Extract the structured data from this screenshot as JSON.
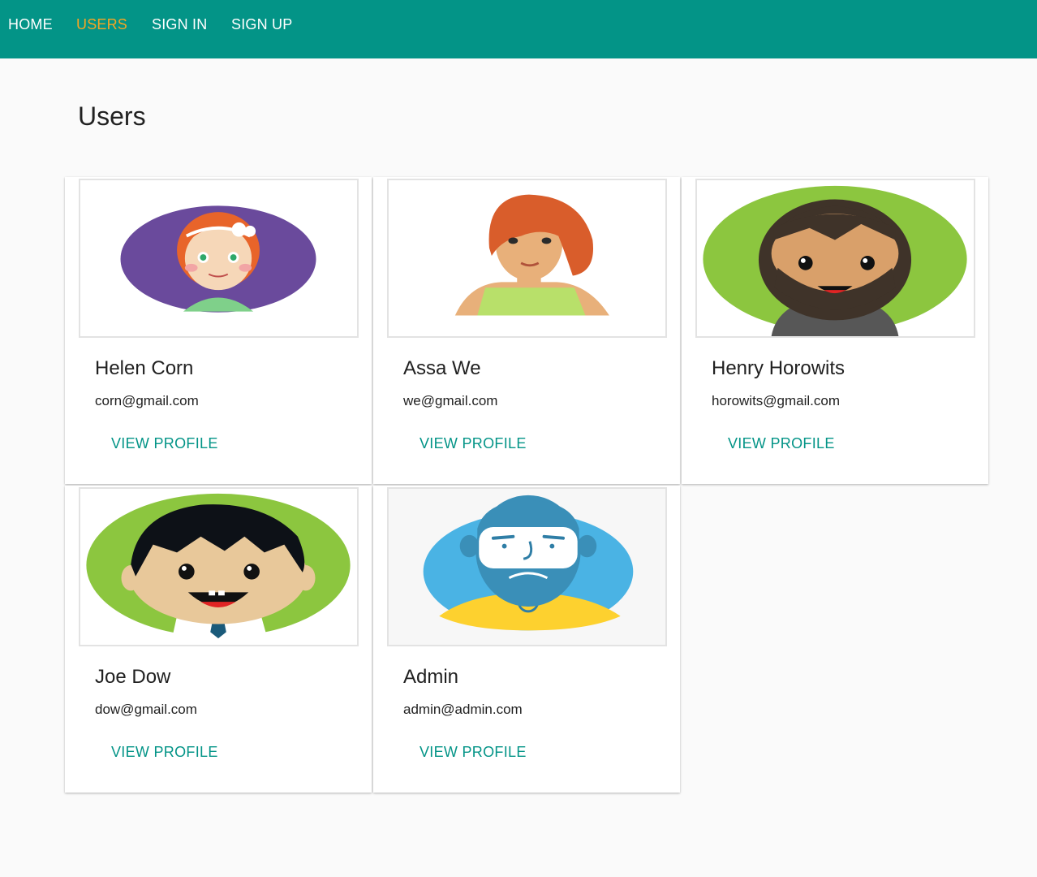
{
  "nav": {
    "home": "HOME",
    "users": "USERS",
    "signin": "SIGN IN",
    "signup": "SIGN UP"
  },
  "page": {
    "title": "Users"
  },
  "users": [
    {
      "name": "Helen Corn",
      "email": "corn@gmail.com",
      "action": "VIEW PROFILE"
    },
    {
      "name": "Assa We",
      "email": "we@gmail.com",
      "action": "VIEW PROFILE"
    },
    {
      "name": "Henry Horowits",
      "email": "horowits@gmail.com",
      "action": "VIEW PROFILE"
    },
    {
      "name": "Joe Dow",
      "email": "dow@gmail.com",
      "action": "VIEW PROFILE"
    },
    {
      "name": "Admin",
      "email": "admin@admin.com",
      "action": "VIEW PROFILE"
    }
  ],
  "colors": {
    "app_bar": "#039487",
    "active_nav": "#f5a623",
    "link": "#039487",
    "background": "#fafafa"
  },
  "icons": [
    "avatar-girl-icon",
    "avatar-woman-icon",
    "avatar-bearded-man-icon",
    "avatar-boy-icon",
    "avatar-admin-icon"
  ]
}
